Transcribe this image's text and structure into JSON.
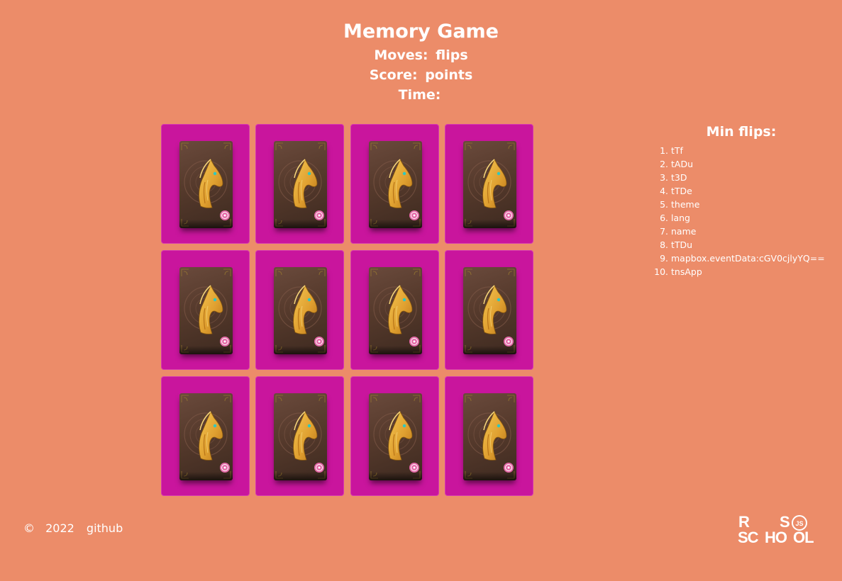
{
  "header": {
    "title": "Memory Game",
    "moves_label": "Moves:",
    "moves_value": "flips",
    "score_label": "Score:",
    "score_value": "points",
    "time_label": "Time:",
    "time_value": ""
  },
  "board": {
    "rows": 3,
    "columns": 4,
    "card_color": "#C9159D",
    "card_back_icon": "golden-horse-icon",
    "cards": [
      {
        "state": "face-down"
      },
      {
        "state": "face-down"
      },
      {
        "state": "face-down"
      },
      {
        "state": "face-down"
      },
      {
        "state": "face-down"
      },
      {
        "state": "face-down"
      },
      {
        "state": "face-down"
      },
      {
        "state": "face-down"
      },
      {
        "state": "face-down"
      },
      {
        "state": "face-down"
      },
      {
        "state": "face-down"
      },
      {
        "state": "face-down"
      }
    ]
  },
  "leaderboard": {
    "title": "Min flips:",
    "items": [
      "tTf",
      "tADu",
      "t3D",
      "tTDe",
      "theme",
      "lang",
      "name",
      "tTDu",
      "mapbox.eventData:cGV0cjlyYQ==",
      "tnsApp"
    ]
  },
  "footer": {
    "copyright": "©",
    "year": "2022",
    "link_label": "github",
    "logo_text_top_left": "R",
    "logo_text_top_right": "S",
    "logo_text_bottom_left": "SC",
    "logo_text_bottom_mid": "HO",
    "logo_text_bottom_right": "OL",
    "logo_badge": "JS"
  },
  "colors": {
    "background": "#EC8C69",
    "card": "#C9159D",
    "text": "#FFFFFF"
  }
}
